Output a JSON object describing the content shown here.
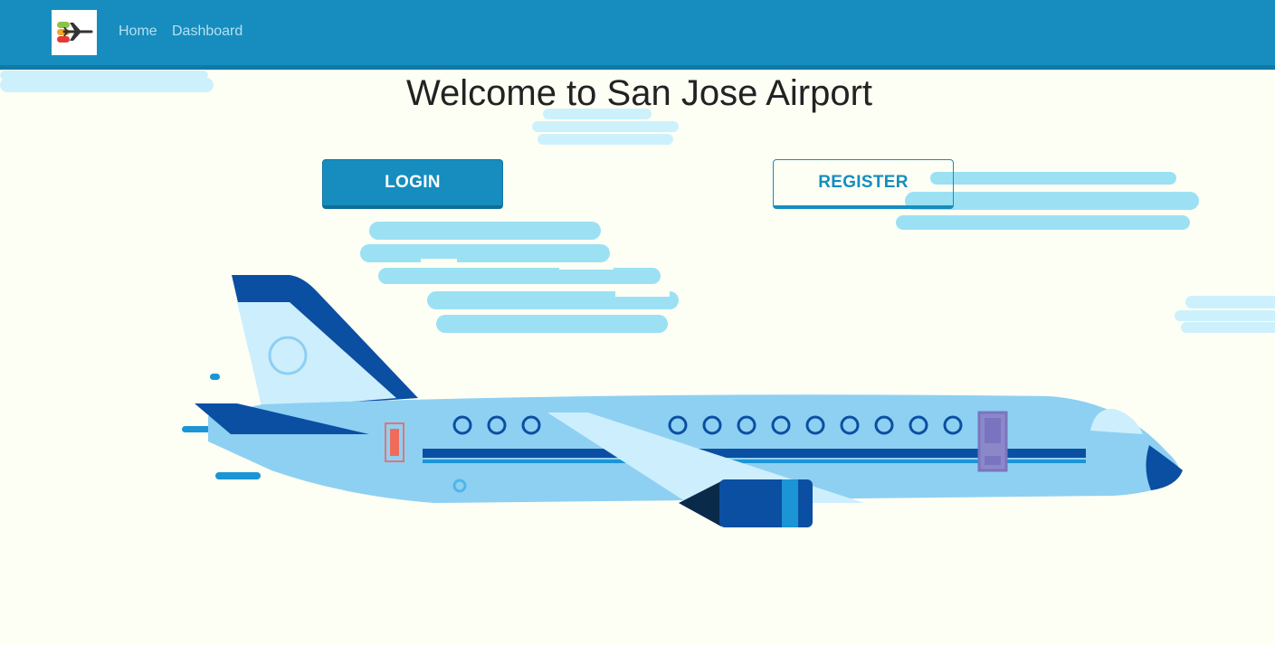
{
  "navbar": {
    "logo_icon": "airplane-logo-icon",
    "links": [
      {
        "label": "Home"
      },
      {
        "label": "Dashboard"
      }
    ],
    "background": "#168dbe"
  },
  "main": {
    "title": "Welcome to San Jose Airport",
    "login_label": "LOGIN",
    "register_label": "REGISTER",
    "illustration_icon": "airplane-illustration"
  },
  "colors": {
    "accent": "#168dbe",
    "page_background": "#fdfff5",
    "cloud_light": "#cdf1fc",
    "cloud": "#9ce1f3"
  }
}
